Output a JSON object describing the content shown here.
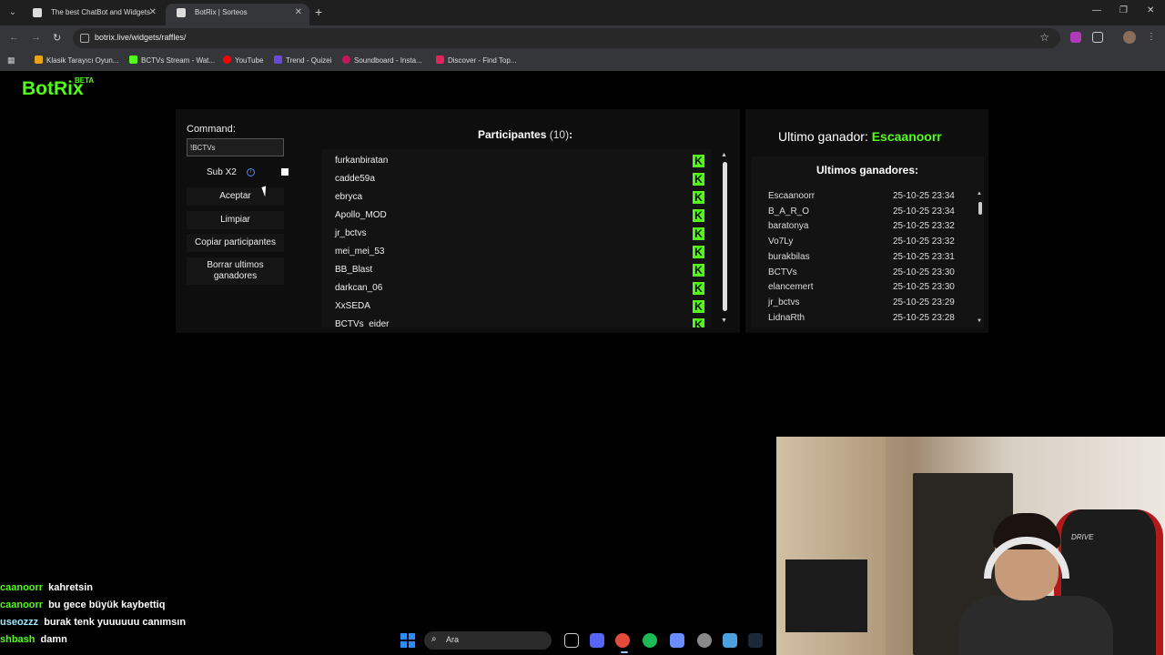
{
  "browser": {
    "tabs": [
      {
        "label": "The best ChatBot and Widgets"
      },
      {
        "label": "BotRix | Sorteos"
      }
    ],
    "url": "botrix.live/widgets/raffles/",
    "bookmarks": [
      {
        "label": "Klasik Tarayıcı Oyun...",
        "color": "#e8a317"
      },
      {
        "label": "BCTVs Stream - Wat...",
        "color": "#53fc18"
      },
      {
        "label": "YouTube",
        "color": "#ff0000"
      },
      {
        "label": "Trend - Quizei",
        "color": "#6a4bd8"
      },
      {
        "label": "Soundboard - Insta...",
        "color": "#c2185b"
      },
      {
        "label": "Discover - Find Top...",
        "color": "#e0245e"
      }
    ]
  },
  "app": {
    "logo": "BotRix",
    "logo_badge": "BETA",
    "accent": "#53fc18"
  },
  "controls": {
    "command_label": "Command:",
    "command_value": "!BCTVs",
    "sub_label": "Sub X2",
    "buttons": {
      "aceptar": "Aceptar",
      "limpiar": "Limpiar",
      "copiar": "Copiar participantes",
      "borrar_line1": "Borrar ultimos",
      "borrar_line2": "ganadores"
    }
  },
  "participants": {
    "title": "Participantes",
    "count": "(10)",
    "suffix": ":",
    "items": [
      "furkanbiratan",
      "cadde59a",
      "ebryca",
      "Apollo_MOD",
      "jr_bctvs",
      "mei_mei_53",
      "BB_Blast",
      "darkcan_06",
      "XxSEDA",
      "BCTVs_eider"
    ]
  },
  "winners": {
    "last_label": "Ultimo ganador:",
    "last_name": "Escaanoorr",
    "list_title": "Ultimos ganadores:",
    "items": [
      {
        "name": "Escaanoorr",
        "date": "25-10-25 23:34"
      },
      {
        "name": "B_A_R_O",
        "date": "25-10-25 23:34"
      },
      {
        "name": "baratonya",
        "date": "25-10-25 23:32"
      },
      {
        "name": "Vo7Ly",
        "date": "25-10-25 23:32"
      },
      {
        "name": "burakbilas",
        "date": "25-10-25 23:31"
      },
      {
        "name": "BCTVs",
        "date": "25-10-25 23:30"
      },
      {
        "name": "elancemert",
        "date": "25-10-25 23:30"
      },
      {
        "name": "jr_bctvs",
        "date": "25-10-25 23:29"
      },
      {
        "name": "LidnaRth",
        "date": "25-10-25 23:28"
      }
    ]
  },
  "chat": [
    {
      "user": "caanoorr",
      "message": "kahretsin"
    },
    {
      "user": "caanoorr",
      "message": "bu gece büyük kaybettiq"
    },
    {
      "user": "useozzz",
      "message": "burak tenk yuuuuuu canımsın"
    },
    {
      "user": "shbash",
      "message": "damn"
    }
  ],
  "webcam": {
    "brand": "DRIVE"
  },
  "taskbar": {
    "search_placeholder": "Ara"
  }
}
